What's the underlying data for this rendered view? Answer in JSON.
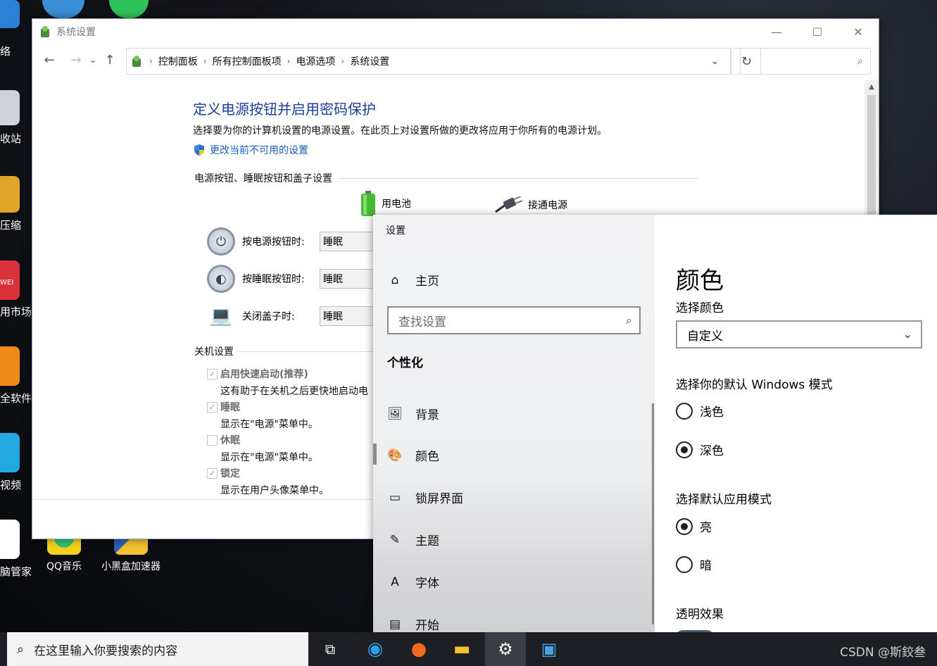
{
  "desktop": {
    "left_labels": [
      "络",
      "收站",
      "压缩",
      "用市场",
      "全软件",
      "视频",
      "脑管家"
    ],
    "left_tile_text": "WEI",
    "icons": [
      {
        "label": "QQ音乐",
        "icon": "qq-music-icon"
      },
      {
        "label": "小黑盒加速器",
        "icon": "xiaoheihe-icon"
      }
    ]
  },
  "control_panel": {
    "window_title": "系统设置",
    "window_controls": {
      "minimize": "—",
      "maximize": "☐",
      "close": "✕"
    },
    "nav": {
      "back": "←",
      "forward": "→",
      "recent": "⌄",
      "up": "↑"
    },
    "breadcrumbs": [
      "控制面板",
      "所有控制面板项",
      "电源选项",
      "系统设置"
    ],
    "address_dropdown": "⌄",
    "refresh": "↻",
    "search_placeholder": "",
    "search_icon": "⌕",
    "heading": "定义电源按钮并启用密码保护",
    "description": "选择要为你的计算机设置的电源设置。在此页上对设置所做的更改将应用于你所有的电源计划。",
    "change_unavailable_link": "更改当前不可用的设置",
    "buttons_section_title": "电源按钮、睡眠按钮和盖子设置",
    "column_battery": "用电池",
    "column_plugged": "接通电源",
    "rows": [
      {
        "label": "按电源按钮时:",
        "value": "睡眠",
        "icon": "power-button-icon",
        "glyph": "⏻"
      },
      {
        "label": "按睡眠按钮时:",
        "value": "睡眠",
        "icon": "sleep-button-icon",
        "glyph": "◐"
      },
      {
        "label": "关闭盖子时:",
        "value": "睡眠",
        "icon": "laptop-lid-icon",
        "glyph": "💻"
      }
    ],
    "shutdown_section_title": "关机设置",
    "shutdown_options": [
      {
        "label": "启用快速启动(推荐)",
        "sub": "这有助于在关机之后更快地启动电",
        "checked": "✓"
      },
      {
        "label": "睡眠",
        "sub": "显示在\"电源\"菜单中。",
        "checked": "✓"
      },
      {
        "label": "休眠",
        "sub": "显示在\"电源\"菜单中。",
        "checked": ""
      },
      {
        "label": "锁定",
        "sub": "显示在用户头像菜单中。",
        "checked": "✓"
      }
    ]
  },
  "settings": {
    "app_title": "设置",
    "home": "主页",
    "home_icon": "⌂",
    "search_placeholder": "查找设置",
    "search_icon": "⌕",
    "section": "个性化",
    "nav_items": [
      {
        "label": "背景",
        "icon": "background-icon",
        "glyph": "🖼"
      },
      {
        "label": "颜色",
        "icon": "palette-icon",
        "glyph": "🎨"
      },
      {
        "label": "锁屏界面",
        "icon": "lock-screen-icon",
        "glyph": "▭"
      },
      {
        "label": "主题",
        "icon": "theme-icon",
        "glyph": "✎"
      },
      {
        "label": "字体",
        "icon": "font-icon",
        "glyph": "A"
      },
      {
        "label": "开始",
        "icon": "start-icon",
        "glyph": "▤"
      }
    ],
    "page_title": "颜色",
    "choose_color_label": "选择颜色",
    "choose_color_value": "自定义",
    "chevron": "⌄",
    "windows_mode_label": "选择你的默认 Windows 模式",
    "windows_mode_options": [
      {
        "label": "浅色",
        "selected": false
      },
      {
        "label": "深色",
        "selected": true
      }
    ],
    "app_mode_label": "选择默认应用模式",
    "app_mode_options": [
      {
        "label": "亮",
        "selected": true
      },
      {
        "label": "暗",
        "selected": false
      }
    ],
    "transparency_label": "透明效果"
  },
  "taskbar": {
    "search_placeholder": "在这里输入你要搜索的内容",
    "search_icon": "⌕",
    "apps": [
      {
        "name": "task-view-icon",
        "glyph": "⧉"
      },
      {
        "name": "edge-icon",
        "glyph": "◉"
      },
      {
        "name": "firefox-icon",
        "glyph": "●"
      },
      {
        "name": "file-explorer-icon",
        "glyph": "▬"
      },
      {
        "name": "settings-gear-icon",
        "glyph": "⚙"
      },
      {
        "name": "control-panel-icon",
        "glyph": "▣"
      }
    ],
    "watermark": "CSDN @斯鉸叁"
  },
  "colors": {
    "link_blue": "#1a5fb4",
    "heading_blue": "#1e3e9a",
    "taskbar": "#1d1f24"
  }
}
